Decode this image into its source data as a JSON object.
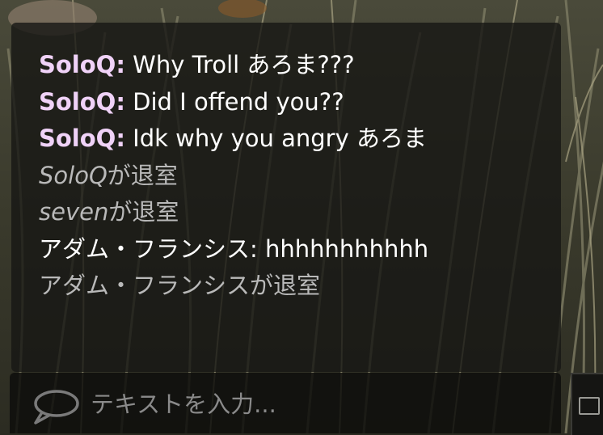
{
  "colors": {
    "sender_name": "#f0d2f8",
    "message_text": "#ffffff",
    "system_text": "#b9b9b9",
    "placeholder": "#8a8a8a",
    "panel_bg": "#161614"
  },
  "chat": {
    "messages": [
      {
        "sender": "SoloQ:",
        "text": " Why Troll あろま???"
      },
      {
        "sender": "SoloQ:",
        "text": " Did I offend you??"
      },
      {
        "sender": "SoloQ:",
        "text": " Idk why you angry あろま"
      },
      {
        "who": "SoloQ",
        "text": "が退室"
      },
      {
        "who": "seven",
        "text": "が退室"
      },
      {
        "line": "アダム・フランシス: hhhhhhhhhhh"
      },
      {
        "line": "アダム・フランシスが退室"
      }
    ]
  },
  "input": {
    "placeholder": "テキストを入力...",
    "value": "",
    "icon": "chat-bubble-icon"
  },
  "side_button": {
    "icon": "window-icon"
  }
}
